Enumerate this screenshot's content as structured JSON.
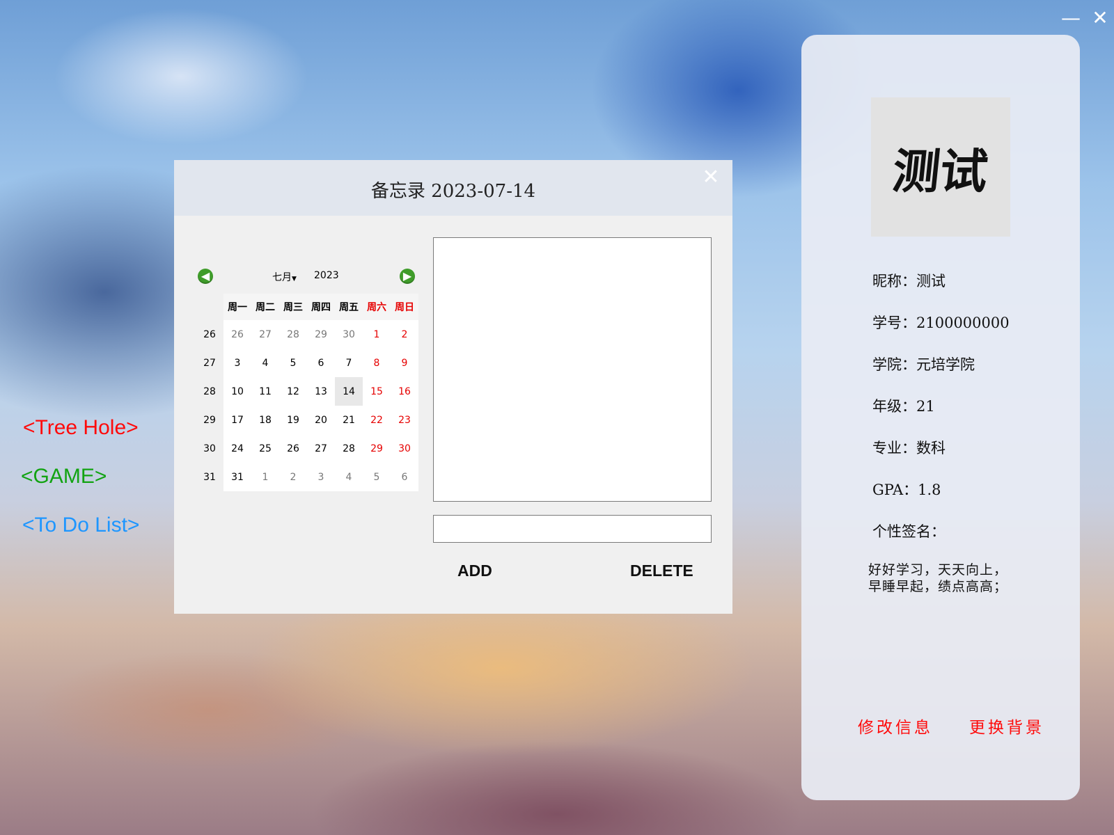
{
  "window": {
    "minimize_icon": "—",
    "close_icon": "✕"
  },
  "nav": {
    "tree_hole": "<Tree Hole>",
    "game": "<GAME>",
    "todo": "<To Do List>"
  },
  "memo": {
    "title": "备忘录 2023-07-14",
    "close_icon": "✕",
    "add_label": "ADD",
    "delete_label": "DELETE",
    "content": "",
    "input_value": ""
  },
  "calendar": {
    "month": "七月",
    "year": "2023",
    "prev_icon": "◀",
    "next_icon": "▶",
    "weekdays": [
      "周一",
      "周二",
      "周三",
      "周四",
      "周五",
      "周六",
      "周日"
    ],
    "weeks": [
      {
        "week": "26",
        "days": [
          "26",
          "27",
          "28",
          "29",
          "30",
          "1",
          "2"
        ]
      },
      {
        "week": "27",
        "days": [
          "3",
          "4",
          "5",
          "6",
          "7",
          "8",
          "9"
        ]
      },
      {
        "week": "28",
        "days": [
          "10",
          "11",
          "12",
          "13",
          "14",
          "15",
          "16"
        ]
      },
      {
        "week": "29",
        "days": [
          "17",
          "18",
          "19",
          "20",
          "21",
          "22",
          "23"
        ]
      },
      {
        "week": "30",
        "days": [
          "24",
          "25",
          "26",
          "27",
          "28",
          "29",
          "30"
        ]
      },
      {
        "week": "31",
        "days": [
          "31",
          "1",
          "2",
          "3",
          "4",
          "5",
          "6"
        ]
      }
    ],
    "selected": "14"
  },
  "profile": {
    "avatar_text": "测试",
    "nickname": "昵称：测试",
    "student_id": "学号：2100000000",
    "college": "学院：元培学院",
    "grade": "年级：21",
    "major": "专业：数科",
    "gpa": "GPA：1.8",
    "signature_label": "个性签名：",
    "signature": "好好学习，天天向上，早睡早起，绩点高高；",
    "edit_button": "修改信息",
    "bg_button": "更换背景"
  },
  "colors": {
    "weekend": "#e60000",
    "tree_hole": "#ff0a0a",
    "game": "#12a312",
    "todo": "#1e96ff"
  }
}
